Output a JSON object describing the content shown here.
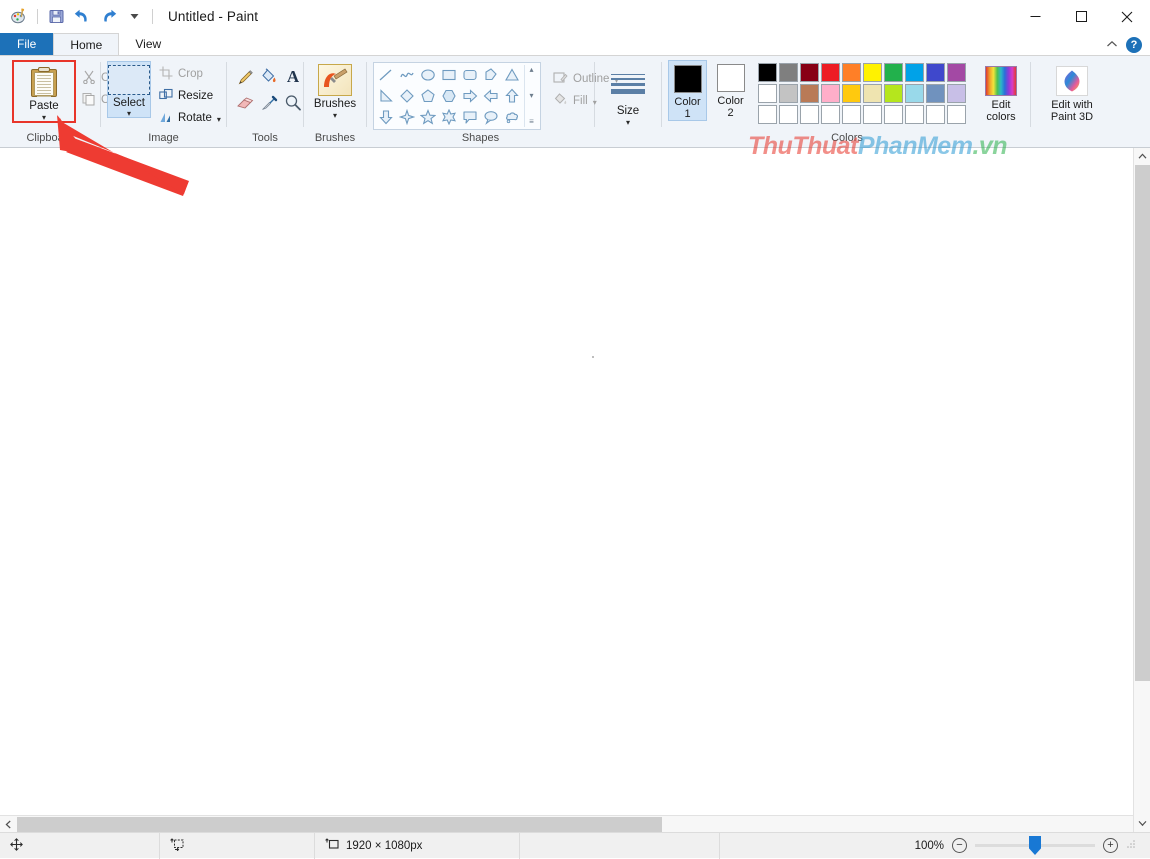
{
  "window": {
    "title": "Untitled - Paint",
    "quick_access": [
      {
        "name": "paint-logo-icon",
        "label": "Paint"
      },
      {
        "name": "save-icon",
        "label": "Save"
      },
      {
        "name": "undo-icon",
        "label": "Undo"
      },
      {
        "name": "redo-icon",
        "label": "Redo"
      },
      {
        "name": "customize-qat-icon",
        "label": "Customize Quick Access Toolbar"
      }
    ],
    "controls": {
      "minimize": "—",
      "maximize": "□",
      "close": "✕"
    }
  },
  "tabs": [
    {
      "label": "File",
      "id": "tab-file",
      "active": false
    },
    {
      "label": "Home",
      "id": "tab-home",
      "active": true
    },
    {
      "label": "View",
      "id": "tab-view",
      "active": false
    }
  ],
  "ribbon_right": {
    "collapse_icon": "⌃",
    "help_label": "?"
  },
  "ribbon": {
    "clipboard": {
      "label": "Clipboard",
      "paste": {
        "label": "Paste",
        "caret": "▾"
      },
      "cut": {
        "label": "Cut",
        "disabled": true
      },
      "copy": {
        "label": "Copy",
        "disabled": true
      }
    },
    "image": {
      "label": "Image",
      "select": {
        "label": "Select",
        "caret": "▾"
      },
      "crop": {
        "label": "Crop",
        "disabled": true
      },
      "resize": {
        "label": "Resize",
        "disabled": false
      },
      "rotate": {
        "label": "Rotate",
        "caret": "▾",
        "disabled": false
      }
    },
    "tools": {
      "label": "Tools",
      "items": [
        {
          "name": "pencil-icon",
          "label": "Pencil"
        },
        {
          "name": "fill-with-color-icon",
          "label": "Fill with color"
        },
        {
          "name": "text-icon",
          "label": "Text"
        },
        {
          "name": "eraser-icon",
          "label": "Eraser"
        },
        {
          "name": "color-picker-icon",
          "label": "Color picker"
        },
        {
          "name": "magnifier-icon",
          "label": "Magnifier"
        }
      ]
    },
    "brushes": {
      "label": "Brushes",
      "caret": "▾"
    },
    "shapes": {
      "label": "Shapes",
      "items": [
        "line",
        "curve",
        "oval",
        "rectangle",
        "rounded-rectangle",
        "polygon",
        "triangle",
        "right-triangle",
        "diamond",
        "pentagon",
        "hexagon",
        "right-arrow",
        "left-arrow",
        "up-arrow",
        "down-arrow",
        "four-point-star",
        "five-point-star",
        "six-point-star",
        "rounded-callout",
        "oval-callout",
        "cloud-callout"
      ],
      "scroll_up": "▴",
      "scroll_down": "▾",
      "scroll_more": "≡",
      "outline": {
        "label": "Outline",
        "caret": "▾",
        "disabled": true
      },
      "fill": {
        "label": "Fill",
        "caret": "▾",
        "disabled": true
      }
    },
    "size": {
      "label": "Size",
      "caret": "▾"
    },
    "colors": {
      "label": "Colors",
      "color1": {
        "label_line1": "Color",
        "label_line2": "1",
        "value": "#000000",
        "selected": true
      },
      "color2": {
        "label_line1": "Color",
        "label_line2": "2",
        "value": "#ffffff",
        "selected": false
      },
      "palette_row1": [
        "#000000",
        "#7f7f7f",
        "#880015",
        "#ed1c24",
        "#ff7f27",
        "#fff200",
        "#22b14c",
        "#00a2e8",
        "#3f48cc",
        "#a349a4"
      ],
      "palette_row2": [
        "#ffffff",
        "#c3c3c3",
        "#b97a57",
        "#ffaec9",
        "#ffc90e",
        "#efe4b0",
        "#b5e61d",
        "#99d9ea",
        "#7092be",
        "#c8bfe7"
      ],
      "palette_row3": [
        "#ffffff",
        "#ffffff",
        "#ffffff",
        "#ffffff",
        "#ffffff",
        "#ffffff",
        "#ffffff",
        "#ffffff",
        "#ffffff",
        "#ffffff"
      ],
      "edit_colors": {
        "label_line1": "Edit",
        "label_line2": "colors"
      }
    },
    "paint3d": {
      "label_line1": "Edit with",
      "label_line2": "Paint 3D"
    }
  },
  "watermark": {
    "parts": [
      {
        "text": "ThuThuat",
        "color": "#e8352a"
      },
      {
        "text": "PhanMem",
        "color": "#2b9bd4"
      },
      {
        "text": ".vn",
        "color": "#2bb14c"
      }
    ]
  },
  "statusbar": {
    "cursor_position": "",
    "selection_size": "",
    "image_size": "1920 × 1080px",
    "zoom_level": "100%",
    "zoom_out": "−",
    "zoom_in": "+"
  },
  "scroll": {
    "v_up": "⌃",
    "v_down": "⌄",
    "h_left": "‹",
    "h_right": "›"
  },
  "annotation": {
    "type": "red-arrow",
    "color": "#ee3b32",
    "points_to": "paste-button"
  }
}
